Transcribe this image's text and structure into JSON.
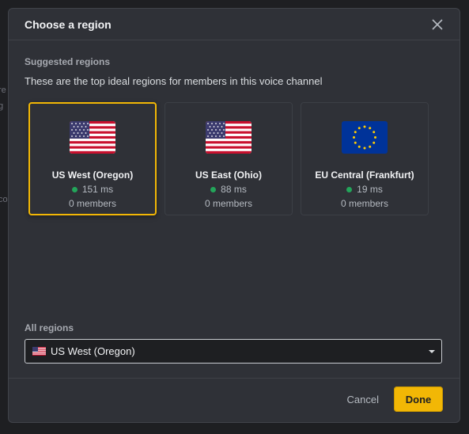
{
  "background": {
    "fragments": [
      "re",
      "g",
      "co"
    ]
  },
  "modal": {
    "title": "Choose a region",
    "close_icon": "close-icon"
  },
  "suggested": {
    "label": "Suggested regions",
    "description": "These are the top ideal regions for members in this voice channel",
    "regions": [
      {
        "name": "US West (Oregon)",
        "ping": "151 ms",
        "members": "0 members",
        "flag": "us-flag-icon",
        "selected": true
      },
      {
        "name": "US East (Ohio)",
        "ping": "88 ms",
        "members": "0 members",
        "flag": "us-flag-icon",
        "selected": false
      },
      {
        "name": "EU Central (Frankfurt)",
        "ping": "19 ms",
        "members": "0 members",
        "flag": "eu-flag-icon",
        "selected": false
      }
    ]
  },
  "all_regions": {
    "label": "All regions",
    "selected_value": "US West (Oregon)",
    "selected_flag": "us-flag-icon"
  },
  "footer": {
    "cancel_label": "Cancel",
    "done_label": "Done"
  },
  "colors": {
    "accent": "#f2b705",
    "online_dot": "#23a55a",
    "modal_bg": "#2f3137",
    "page_bg": "#1e1f22"
  }
}
